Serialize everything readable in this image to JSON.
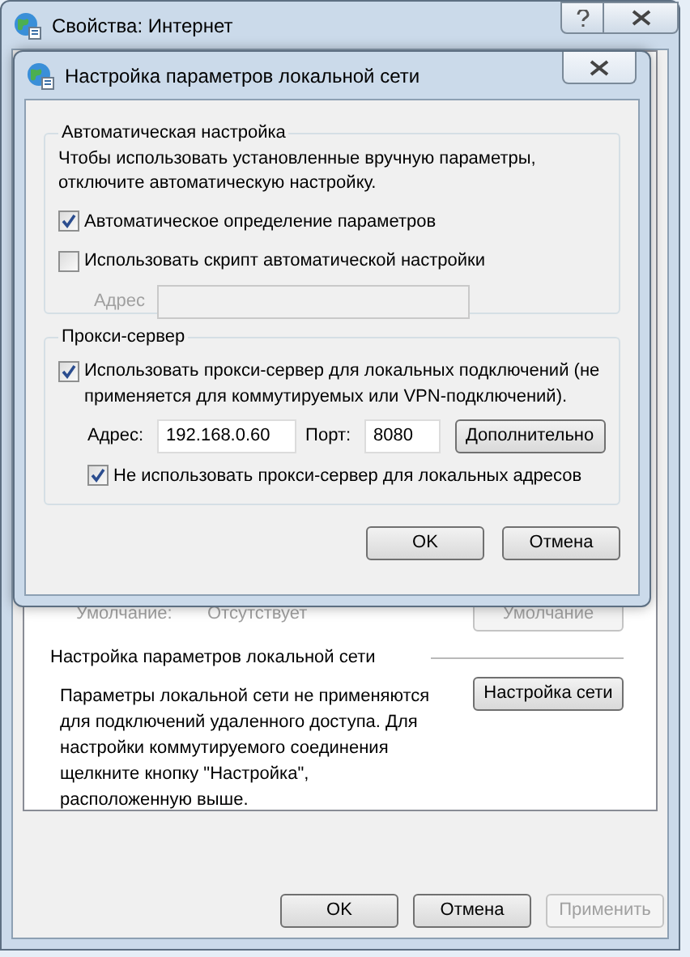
{
  "window": {
    "title": "Свойства: Интернет"
  },
  "default_row": {
    "label": "Умолчание:",
    "value": "Отсутствует",
    "button": "Умолчание",
    "disabled": true
  },
  "lan_section": {
    "title": "Настройка параметров локальной сети",
    "text": "Параметры локальной сети не применяются для подключений удаленного доступа. Для настройки коммутируемого соединения щелкните кнопку \"Настройка\", расположенную выше.",
    "button": "Настройка сети"
  },
  "buttons": [
    {
      "label": "OK",
      "disabled": false
    },
    {
      "label": "Отмена",
      "disabled": false
    },
    {
      "label": "Применить",
      "disabled": true
    }
  ],
  "dialog": {
    "title": "Настройка параметров локальной сети",
    "auto_group": {
      "title": "Автоматическая настройка",
      "description": "Чтобы использовать установленные вручную параметры, отключите автоматическую настройку.",
      "options": [
        {
          "label": "Автоматическое определение параметров",
          "checked": true
        },
        {
          "label": "Использовать скрипт автоматической настройки",
          "checked": false
        }
      ],
      "address": {
        "label": "Адрес",
        "disabled": true
      }
    },
    "proxy_group": {
      "title": "Прокси-сервер",
      "use_proxy": {
        "label": "Использовать прокси-сервер для локальных подключений (не применяется для коммутируемых или VPN-подключений).",
        "checked": true
      },
      "address": {
        "label": "Адрес:",
        "value": "192.168.0.60"
      },
      "port": {
        "label": "Порт:",
        "value": "8080"
      },
      "advanced_button": "Дополнительно",
      "bypass_local": {
        "label": "Не использовать прокси-сервер для локальных адресов",
        "checked": true
      }
    },
    "buttons": [
      {
        "label": "OK"
      },
      {
        "label": "Отмена"
      }
    ]
  }
}
